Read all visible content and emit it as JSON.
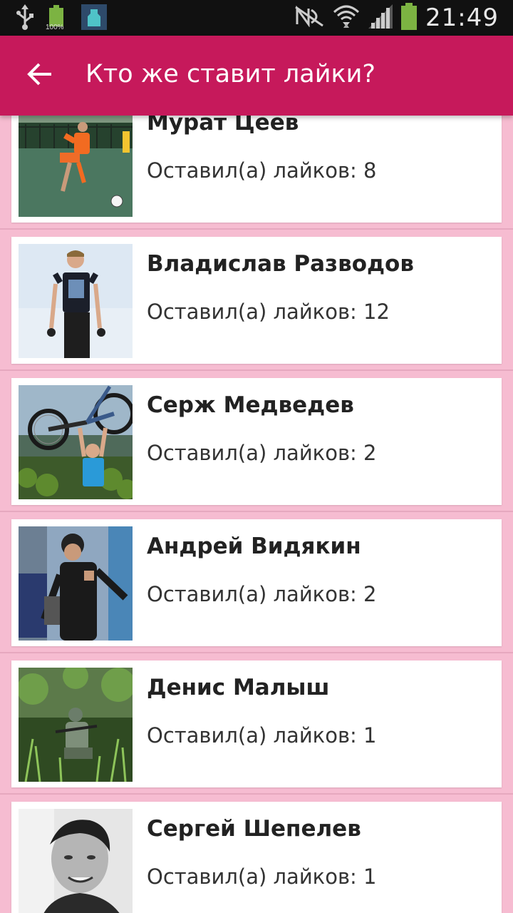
{
  "status_bar": {
    "battery_label": "100%",
    "time": "21:49",
    "icons": [
      "usb-icon",
      "battery-full-icon",
      "app-notification-icon",
      "nfc-off-icon",
      "wifi-icon",
      "signal-icon",
      "battery-icon"
    ]
  },
  "app_bar": {
    "title": "Кто же ставит лайки?",
    "back_icon": "arrow-left-icon",
    "color": "#c6195b"
  },
  "users": [
    {
      "name": "Мурат Цеев",
      "likes_text": "Оставил(а) лайков: 8",
      "likes": 8
    },
    {
      "name": "Владислав Разводов",
      "likes_text": "Оставил(а) лайков: 12",
      "likes": 12
    },
    {
      "name": "Серж Медведев",
      "likes_text": "Оставил(а) лайков: 2",
      "likes": 2
    },
    {
      "name": "Андрей Видякин",
      "likes_text": "Оставил(а) лайков: 2",
      "likes": 2
    },
    {
      "name": "Денис Малыш",
      "likes_text": "Оставил(а) лайков: 1",
      "likes": 1
    },
    {
      "name": "Сергей Шепелев",
      "likes_text": "Оставил(а) лайков: 1",
      "likes": 1
    }
  ],
  "colors": {
    "background": "#f6bcd1",
    "card": "#ffffff",
    "status_bar": "#111111"
  }
}
